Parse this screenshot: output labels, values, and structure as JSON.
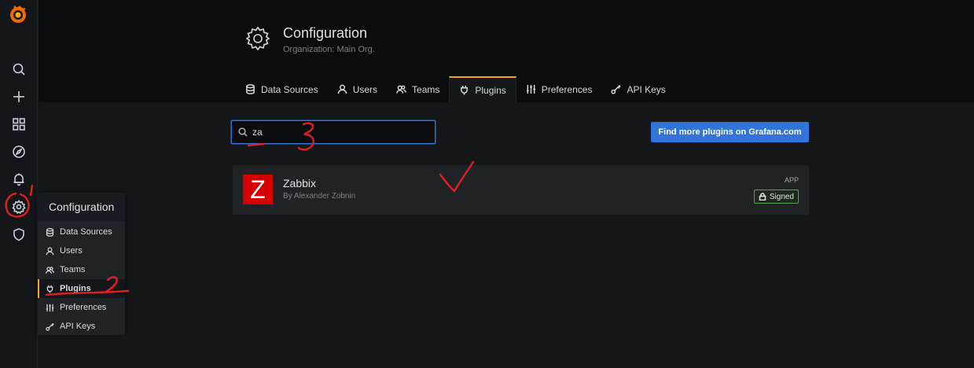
{
  "sidemenu": {
    "icons": [
      "grafana-logo-icon",
      "search-icon",
      "plus-icon",
      "dashboards-icon",
      "explore-icon",
      "alerting-icon",
      "gear-icon",
      "shield-icon"
    ]
  },
  "page": {
    "title": "Configuration",
    "subtitle": "Organization: Main Org."
  },
  "tabs": [
    {
      "label": "Data Sources",
      "icon": "database-icon"
    },
    {
      "label": "Users",
      "icon": "user-icon"
    },
    {
      "label": "Teams",
      "icon": "users-icon"
    },
    {
      "label": "Plugins",
      "icon": "plug-icon",
      "active": true
    },
    {
      "label": "Preferences",
      "icon": "sliders-icon"
    },
    {
      "label": "API Keys",
      "icon": "key-icon"
    }
  ],
  "search": {
    "value": "za",
    "placeholder": ""
  },
  "find_button": "Find more plugins on Grafana.com",
  "plugin": {
    "logo_letter": "Z",
    "name": "Zabbix",
    "author": "By Alexander Zobnin",
    "type": "APP",
    "badge": "Signed"
  },
  "flyout": {
    "header": "Configuration",
    "items": [
      {
        "label": "Data Sources"
      },
      {
        "label": "Users"
      },
      {
        "label": "Teams"
      },
      {
        "label": "Plugins",
        "active": true
      },
      {
        "label": "Preferences"
      },
      {
        "label": "API Keys"
      }
    ]
  },
  "colors": {
    "accent": "#f5a524",
    "primary": "#3274d9",
    "signed": "#56a64b",
    "annotation": "#e02020"
  }
}
